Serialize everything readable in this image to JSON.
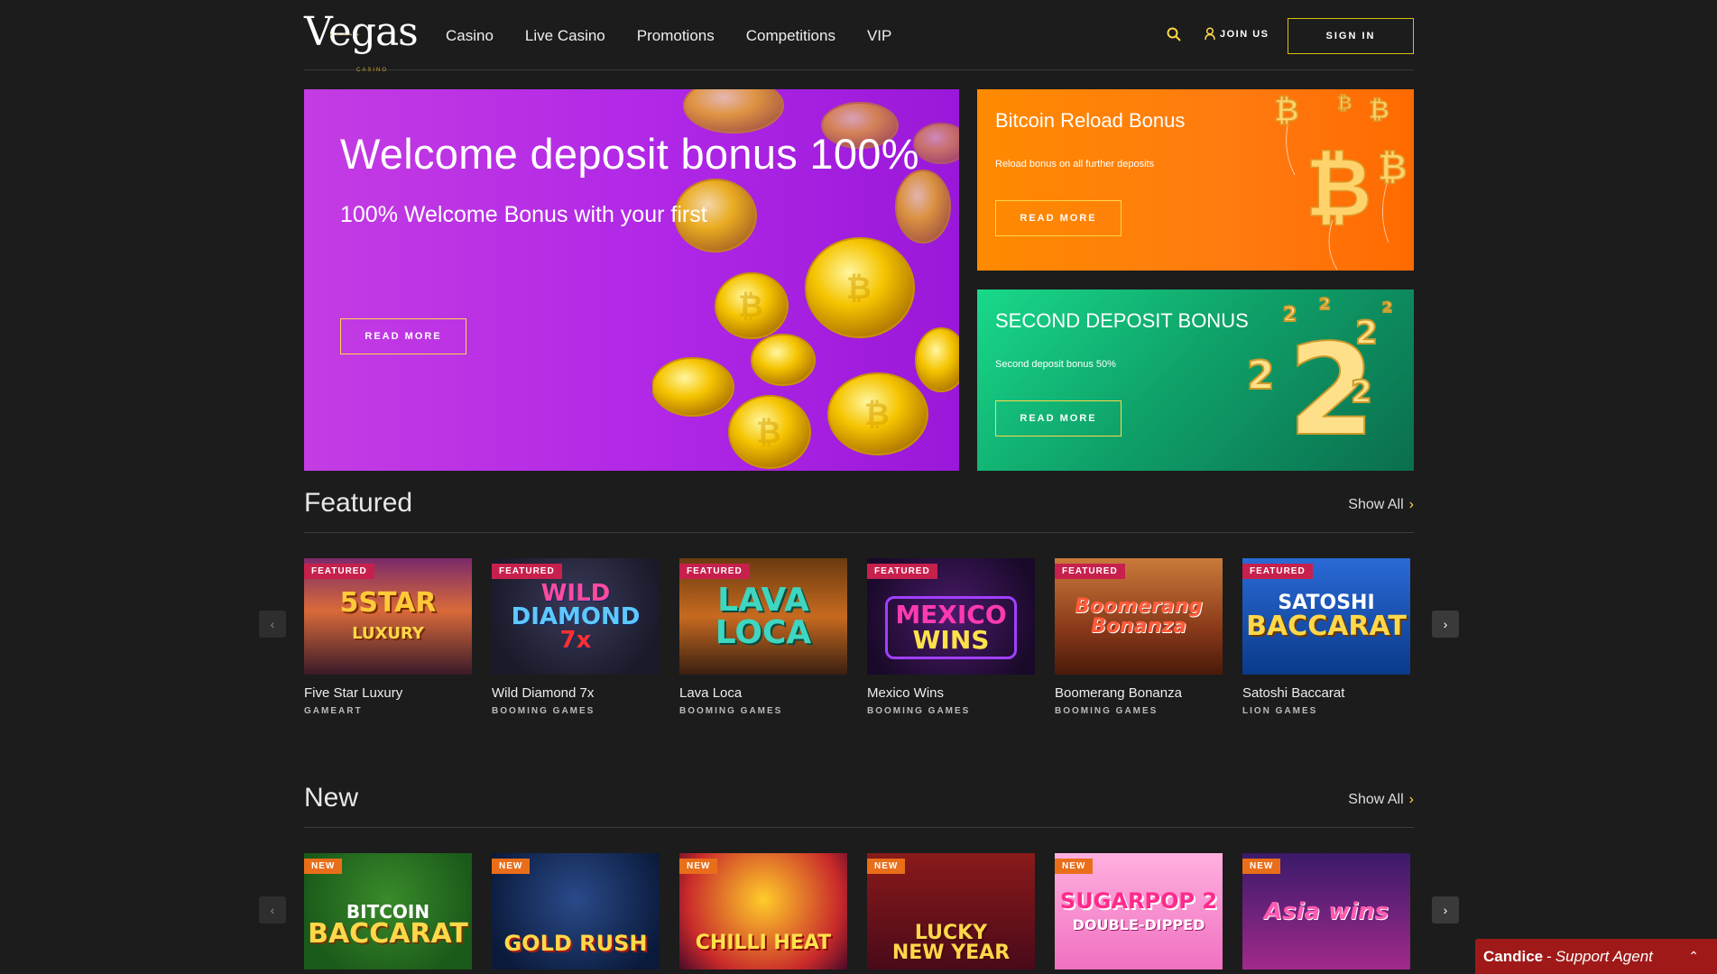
{
  "header": {
    "logo": "Vegas",
    "logo_sub": "CASINO",
    "nav": [
      "Casino",
      "Live Casino",
      "Promotions",
      "Competitions",
      "VIP"
    ],
    "join_label": "JOIN US",
    "signin_label": "SIGN IN"
  },
  "hero": {
    "title": "Welcome deposit bonus 100%",
    "subtitle": "100% Welcome Bonus with your first",
    "button": "READ MORE"
  },
  "side_banners": [
    {
      "title": "Bitcoin Reload Bonus",
      "desc": "Reload bonus on all further deposits",
      "button": "READ MORE"
    },
    {
      "title": "SECOND DEPOSIT BONUS",
      "desc": "Second deposit bonus 50%",
      "button": "READ MORE"
    }
  ],
  "featured": {
    "heading": "Featured",
    "show_all": "Show All",
    "badge": "FEATURED",
    "games": [
      {
        "name": "Five Star Luxury",
        "provider": "GAMEART",
        "art": "5STAR\nLUXURY"
      },
      {
        "name": "Wild Diamond 7x",
        "provider": "BOOMING GAMES",
        "art": "WILD\nDIAMOND\n7x"
      },
      {
        "name": "Lava Loca",
        "provider": "BOOMING GAMES",
        "art": "LAVA\nLOCA"
      },
      {
        "name": "Mexico Wins",
        "provider": "BOOMING GAMES",
        "art": "MEXICO\nWINS"
      },
      {
        "name": "Boomerang Bonanza",
        "provider": "BOOMING GAMES",
        "art": "Boomerang\nBonanza"
      },
      {
        "name": "Satoshi Baccarat",
        "provider": "LION GAMES",
        "art": "SATOSHI\nBACCARAT"
      }
    ]
  },
  "new": {
    "heading": "New",
    "show_all": "Show All",
    "badge": "NEW",
    "games": [
      {
        "art": "BITCOIN\nBACCARAT"
      },
      {
        "art": "GOLD RUSH"
      },
      {
        "art": "CHILLI HEAT"
      },
      {
        "art": "LUCKY\nNEW YEAR"
      },
      {
        "art": "SUGARPOP 2\nDOUBLE-DIPPED"
      },
      {
        "art": "Asia wins"
      }
    ]
  },
  "support": {
    "name": "Candice",
    "role": "Support Agent"
  },
  "colors": {
    "accent": "#ffd84a",
    "featured_badge": "#c7204d",
    "new_badge": "#e96e1a",
    "support": "#a01919"
  }
}
